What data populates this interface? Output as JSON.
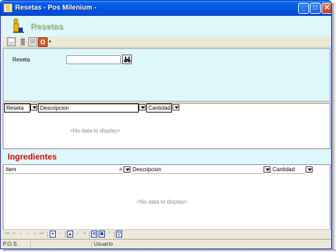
{
  "window": {
    "title": "Resetas - Pos Milenium -",
    "minimize": "_",
    "maximize": "□",
    "close": "✕"
  },
  "header": {
    "title": "Resetas",
    "icon": "figure-icon"
  },
  "toolbar": {
    "items": [
      "save-icon",
      "trash-icon",
      "cancel-icon",
      "power-icon",
      "dropdown-arrow"
    ],
    "cancel_glyph": "⊠",
    "power_glyph": "O",
    "dropdown_glyph": "▾"
  },
  "form": {
    "reseta_label": "Reseta",
    "reseta_value": "",
    "search_icon": "binoculars-icon"
  },
  "grid_resetas": {
    "columns": [
      "Reseta",
      "Descripcion",
      "Cantidad"
    ],
    "empty_text": "<No data to display>"
  },
  "ingredientes": {
    "title": "Ingredientes",
    "columns": [
      "Item",
      "Descripcion",
      "Cantidad"
    ],
    "empty_text": "<No data to display>"
  },
  "navigator": {
    "buttons": [
      "⏮",
      "«",
      "‹",
      "›",
      "»",
      "⏭",
      "+",
      "−",
      "▲",
      "✓",
      "✕",
      "⟲",
      "✱",
      "*",
      "▽"
    ]
  },
  "statusbar": {
    "cells": [
      "P.O.S.",
      "",
      "Usuario"
    ]
  },
  "colors": {
    "panel_bg": "#ddf7fa",
    "ingredientes_title": "#e00000",
    "header_title": "#b6dbb2",
    "titlebar": "#0054e3"
  }
}
